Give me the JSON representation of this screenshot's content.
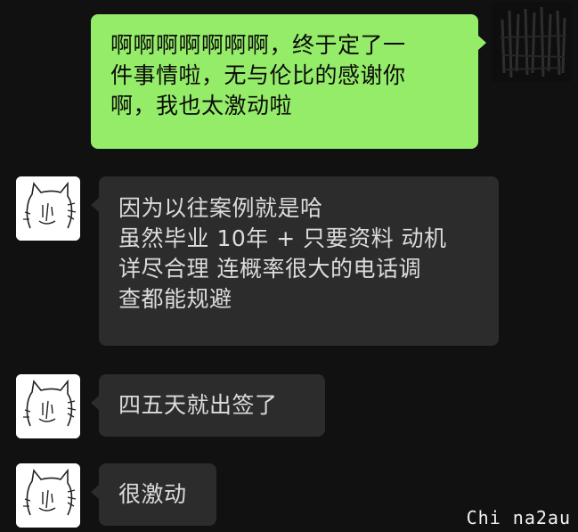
{
  "watermark": "Chi na2au",
  "messages": [
    {
      "side": "out",
      "lines": [
        "啊啊啊啊啊啊啊，终于定了一",
        "件事情啦，无与伦比的感谢你",
        "啊，我也太激动啦"
      ]
    },
    {
      "side": "in",
      "lines": [
        "因为以往案例就是哈",
        "虽然毕业 10年 + 只要资料 动机",
        "详尽合理 连概率很大的电话调",
        "查都能规避"
      ]
    },
    {
      "side": "in",
      "lines": [
        "四五天就出签了"
      ]
    },
    {
      "side": "in",
      "lines": [
        "很激动"
      ]
    }
  ],
  "icons": {
    "self_avatar": "dark-illustration-avatar",
    "contact_avatar": "cat-sketch-avatar"
  },
  "colors": {
    "background": "#111111",
    "outgoing_bubble": "#95ec69",
    "incoming_bubble": "#2c2c2c"
  }
}
